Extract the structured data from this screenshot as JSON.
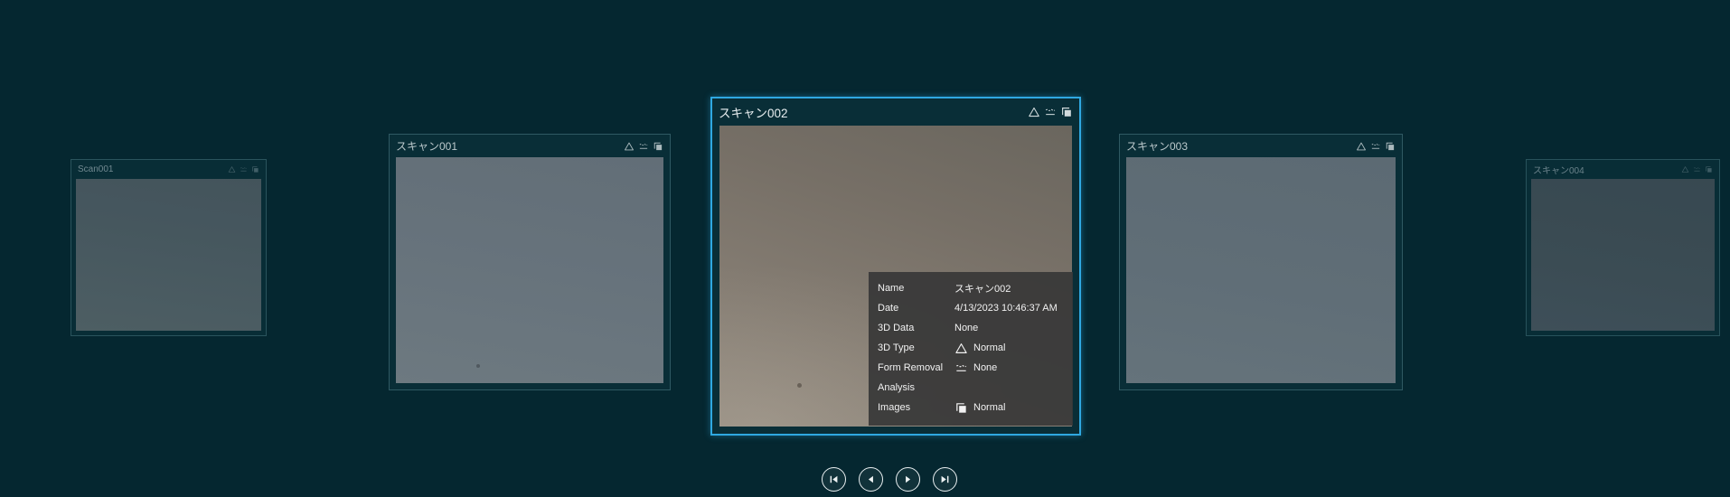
{
  "app": {
    "background_color": "#052730",
    "accent_color": "#2fa8e1",
    "overlay_color": "#383838"
  },
  "carousel": {
    "cards": [
      {
        "title": "Scan001",
        "selected": false
      },
      {
        "title": "スキャン001",
        "selected": false
      },
      {
        "title": "スキャン002",
        "selected": true
      },
      {
        "title": "スキャン003",
        "selected": false
      },
      {
        "title": "スキャン004",
        "selected": false
      }
    ]
  },
  "card_status_icons": [
    "3d-type-icon",
    "form-removal-icon",
    "images-icon"
  ],
  "info_overlay": {
    "rows": [
      {
        "label": "Name",
        "value": "スキャン002",
        "icon": ""
      },
      {
        "label": "Date",
        "value": "4/13/2023 10:46:37 AM",
        "icon": ""
      },
      {
        "label": "3D Data",
        "value": "None",
        "icon": ""
      },
      {
        "label": "3D Type",
        "value": "Normal",
        "icon": "triangle-outline"
      },
      {
        "label": "Form Removal",
        "value": "None",
        "icon": "wave-over-line"
      },
      {
        "label": "Analysis",
        "value": "",
        "icon": ""
      },
      {
        "label": "Images",
        "value": "Normal",
        "icon": "stacked-squares"
      }
    ]
  },
  "navigation": {
    "buttons": [
      {
        "name": "skip-to-first"
      },
      {
        "name": "previous"
      },
      {
        "name": "next"
      },
      {
        "name": "skip-to-last"
      }
    ]
  }
}
